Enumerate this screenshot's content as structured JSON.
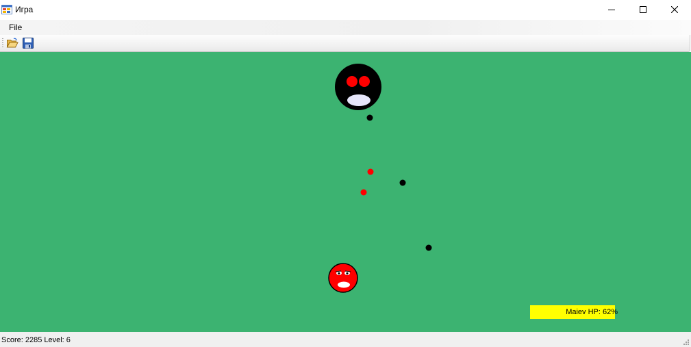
{
  "window": {
    "title": "Игра",
    "icon": "windows-forms-app-icon",
    "controls": [
      "minimize-icon",
      "maximize-icon",
      "close-icon"
    ]
  },
  "menu": {
    "items": [
      {
        "label": "File"
      }
    ]
  },
  "toolbar": {
    "buttons": [
      {
        "name": "open",
        "icon": "open-folder-icon"
      },
      {
        "name": "save",
        "icon": "floppy-disk-save-icon"
      }
    ]
  },
  "game": {
    "background_color": "#3cb371",
    "boss": {
      "color": "#000000",
      "eye_color": "#ff0000",
      "mouth_color": "#e6e6fa"
    },
    "player": {
      "color": "#ff0000",
      "eye_color": "#ffffff",
      "mouth_color": "#ffffff"
    },
    "projectiles": [
      {
        "color": "#000000"
      },
      {
        "color": "#ff0000"
      },
      {
        "color": "#000000"
      },
      {
        "color": "#ff0000"
      },
      {
        "color": "#000000"
      }
    ],
    "boss_hp": {
      "label": "Maiev HP: 62%",
      "percent": 62,
      "color": "#ffff00"
    }
  },
  "status": {
    "text": "Score: 2285 Level: 6",
    "score": 2285,
    "level": 6
  }
}
